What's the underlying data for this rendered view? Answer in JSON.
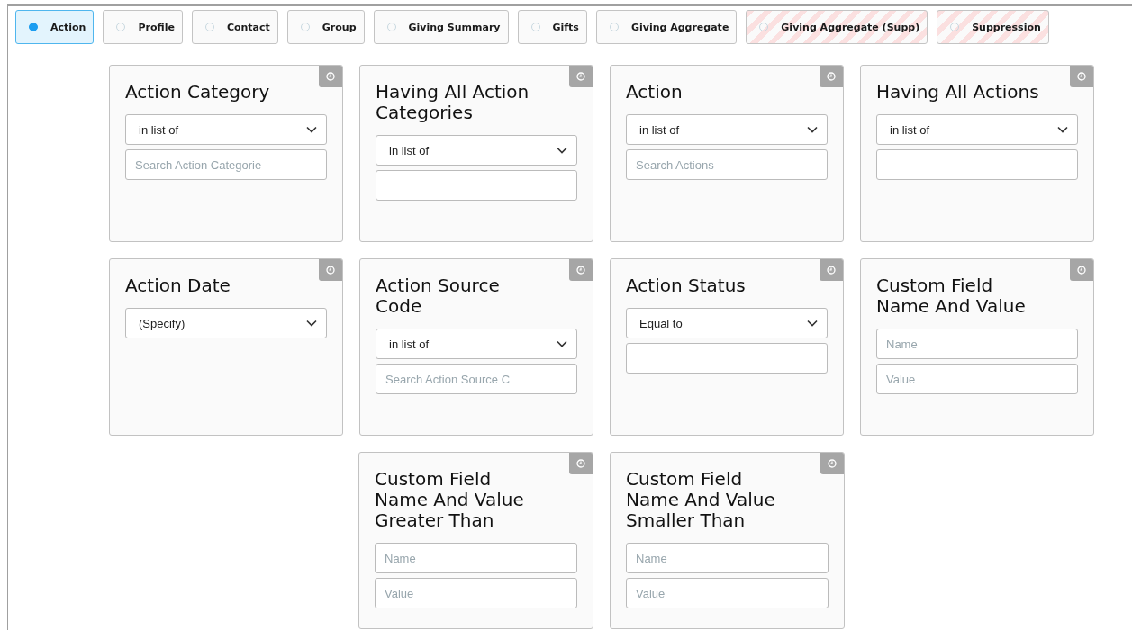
{
  "tabs": [
    {
      "label": "Action",
      "selected": true,
      "restricted": false
    },
    {
      "label": "Profile",
      "selected": false,
      "restricted": false
    },
    {
      "label": "Contact",
      "selected": false,
      "restricted": false
    },
    {
      "label": "Group",
      "selected": false,
      "restricted": false
    },
    {
      "label": "Giving Summary",
      "selected": false,
      "restricted": false
    },
    {
      "label": "Gifts",
      "selected": false,
      "restricted": false
    },
    {
      "label": "Giving Aggregate",
      "selected": false,
      "restricted": false
    },
    {
      "label": "Giving Aggregate (Supp)",
      "selected": false,
      "restricted": true
    },
    {
      "label": "Suppression",
      "selected": false,
      "restricted": true
    }
  ],
  "card_rows": [
    [
      {
        "title": "Action Category",
        "fields": [
          {
            "kind": "select",
            "value": "in list of"
          },
          {
            "kind": "input",
            "placeholder": "Search Action Categorie"
          }
        ]
      },
      {
        "title": "Having All Action Categories",
        "fields": [
          {
            "kind": "select",
            "value": "in list of"
          },
          {
            "kind": "input"
          }
        ]
      },
      {
        "title": "Action",
        "fields": [
          {
            "kind": "select",
            "value": "in list of"
          },
          {
            "kind": "input",
            "placeholder": "Search Actions"
          }
        ]
      },
      {
        "title": "Having All Actions",
        "fields": [
          {
            "kind": "select",
            "value": "in list of"
          },
          {
            "kind": "input"
          }
        ]
      }
    ],
    [
      {
        "title": "Action Date",
        "fields": [
          {
            "kind": "select",
            "value": "(Specify)"
          }
        ]
      },
      {
        "title": "Action Source Code",
        "fields": [
          {
            "kind": "select",
            "value": "in list of"
          },
          {
            "kind": "input",
            "placeholder": "Search Action Source C"
          }
        ]
      },
      {
        "title": "Action Status",
        "fields": [
          {
            "kind": "select",
            "value": "Equal to"
          },
          {
            "kind": "input"
          }
        ]
      },
      {
        "title": "Custom Field Name And Value",
        "fields": [
          {
            "kind": "input",
            "placeholder": "Name"
          },
          {
            "kind": "input",
            "placeholder": "Value"
          }
        ]
      }
    ],
    [
      {
        "title": "Custom Field Name And Value Greater Than",
        "fields": [
          {
            "kind": "input",
            "placeholder": "Name"
          },
          {
            "kind": "input",
            "placeholder": "Value"
          }
        ]
      },
      {
        "title": "Custom Field Name And Value Smaller Than",
        "fields": [
          {
            "kind": "input",
            "placeholder": "Name"
          },
          {
            "kind": "input",
            "placeholder": "Value"
          }
        ]
      }
    ]
  ]
}
